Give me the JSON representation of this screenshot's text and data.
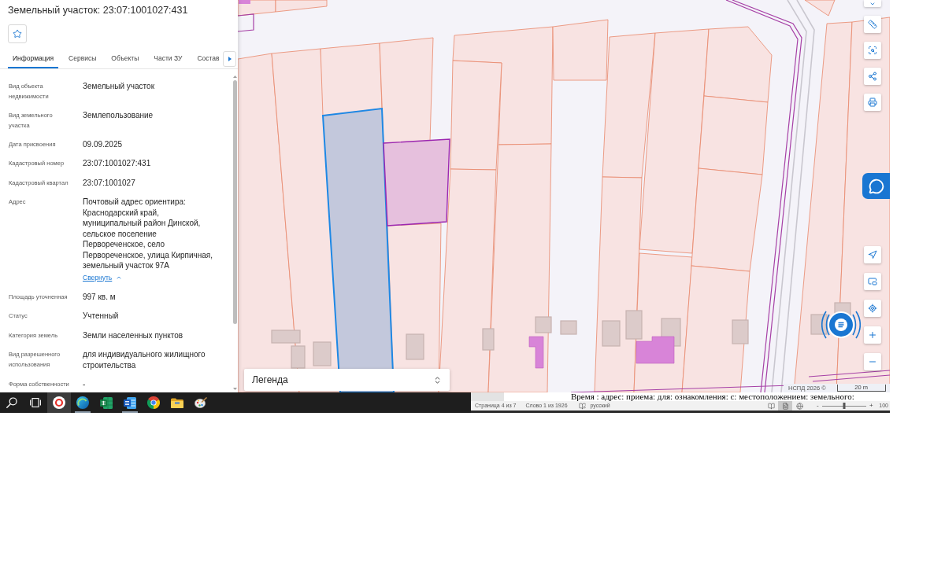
{
  "panel": {
    "title": "Земельный участок: 23:07:1001027:431",
    "favorite": false,
    "tabs": [
      {
        "label": "Информация",
        "selected": true
      },
      {
        "label": "Сервисы",
        "selected": false
      },
      {
        "label": "Объекты",
        "selected": false
      },
      {
        "label": "Части ЗУ",
        "selected": false
      },
      {
        "label": "Состав",
        "selected": false
      }
    ],
    "fields": [
      {
        "label": "Вид объекта недвижимости",
        "value": "Земельный участок"
      },
      {
        "label": "Вид земельного участка",
        "value": "Землепользование"
      },
      {
        "label": "Дата присвоения",
        "value": "09.09.2025"
      },
      {
        "label": "Кадастровый номер",
        "value": "23:07:1001027:431"
      },
      {
        "label": "Кадастровый квартал",
        "value": "23:07:1001027"
      },
      {
        "label": "Адрес",
        "value": "Почтовый адрес ориентира: Краснодарский край, муниципальный район Динской, сельское поселение Первореченское, село Первореченское, улица Кирпичная, земельный участок 97А",
        "toggle": "Свернуть",
        "expanded": true
      },
      {
        "label": "Площадь уточненная",
        "value": "997 кв. м"
      },
      {
        "label": "Статус",
        "value": "Учтенный"
      },
      {
        "label": "Категория земель",
        "value": "Земли населенных пунктов"
      },
      {
        "label": "Вид разрешенного использования",
        "value": "для индивидуального жилищного строительства"
      },
      {
        "label": "Форма собственности",
        "value": "-"
      }
    ]
  },
  "map": {
    "legend": "Легенда",
    "attribution": "НСПД 2026 ©",
    "scale": "20 m"
  },
  "taskbar": {
    "items": [
      {
        "kind": "search",
        "active": false,
        "running": false
      },
      {
        "kind": "task_view",
        "active": false,
        "running": false
      },
      {
        "kind": "disc_browser",
        "active": true,
        "running": false
      },
      {
        "kind": "swirl_browser",
        "active": false,
        "running": true
      },
      {
        "kind": "spreadsheet",
        "active": false,
        "running": false
      },
      {
        "kind": "document",
        "active": false,
        "running": true
      },
      {
        "kind": "ball_browser",
        "active": false,
        "running": false
      },
      {
        "kind": "folder",
        "active": false,
        "running": false
      },
      {
        "kind": "palette",
        "active": false,
        "running": false
      }
    ]
  },
  "document": {
    "text": "Время : адрес: приема: для: ознакомления: с: местоположением: земельного:"
  },
  "status_bar": {
    "page": "Страница 4 из 7",
    "words": "Слово 1 из 1926",
    "language": "русский",
    "views": [
      {
        "kind": "read",
        "selected": false
      },
      {
        "kind": "print",
        "selected": true
      },
      {
        "kind": "web",
        "selected": false
      }
    ],
    "zoom_out": "-",
    "zoom": {
      "level": 0.5
    },
    "zoom_in": "+",
    "zoom_reading": "100"
  }
}
